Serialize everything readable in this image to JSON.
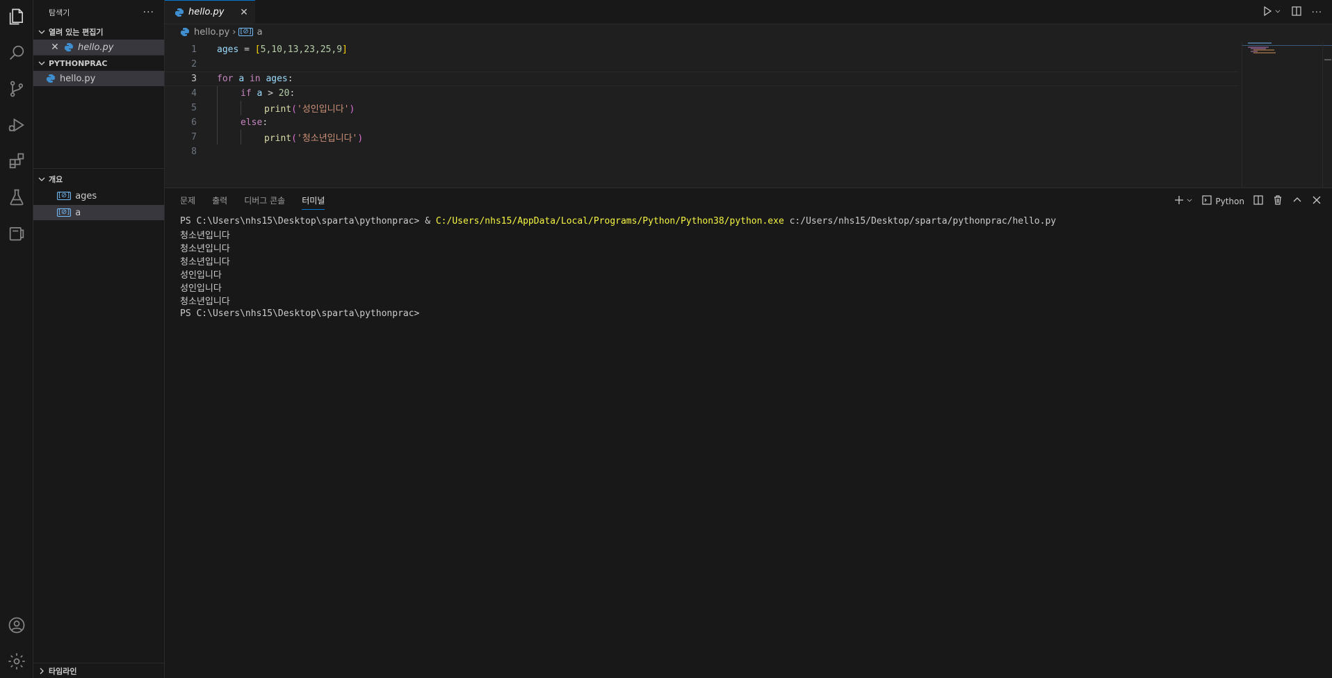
{
  "sidebar": {
    "title": "탐색기",
    "more": "···",
    "open_editors": {
      "header": "열려 있는 편집기",
      "items": [
        {
          "label": "hello.py"
        }
      ]
    },
    "project": {
      "header": "PYTHONPRAC",
      "items": [
        {
          "label": "hello.py"
        }
      ]
    },
    "outline": {
      "header": "개요",
      "items": [
        {
          "label": "ages",
          "icon": "[⊘]"
        },
        {
          "label": "a",
          "icon": "[⊘]"
        }
      ]
    },
    "timeline": {
      "header": "타임라인"
    }
  },
  "editor": {
    "tab": {
      "label": "hello.py"
    },
    "breadcrumb": {
      "file": "hello.py",
      "symbol": "a",
      "separator": "›"
    },
    "lines": [
      "1",
      "2",
      "3",
      "4",
      "5",
      "6",
      "7",
      "8"
    ]
  },
  "code": {
    "l1": {
      "var": "ages",
      "eq": " = ",
      "open": "[",
      "nums": "5,10,13,23,25,9",
      "close": "]"
    },
    "l3": {
      "for": "for",
      "a": "a",
      "in": "in",
      "ages": "ages",
      "colon": ":"
    },
    "l4": {
      "if": "if",
      "a": "a",
      "gt": " > ",
      "num": "20",
      "colon": ":"
    },
    "l5": {
      "fn": "print",
      "open": "(",
      "str": "'성인입니다'",
      "close": ")"
    },
    "l6": {
      "else": "else",
      "colon": ":"
    },
    "l7": {
      "fn": "print",
      "open": "(",
      "str": "'청소년입니다'",
      "close": ")"
    }
  },
  "panel": {
    "tabs": [
      {
        "label": "문제"
      },
      {
        "label": "출력"
      },
      {
        "label": "디버그 콘솔"
      },
      {
        "label": "터미널"
      }
    ],
    "terminal_profile": "Python",
    "terminal": {
      "cmd_prompt": "PS C:\\Users\\nhs15\\Desktop\\sparta\\pythonprac> & ",
      "cmd_exe": "C:/Users/nhs15/AppData/Local/Programs/Python/Python38/python.exe",
      "cmd_arg": " c:/Users/nhs15/Desktop/sparta/pythonprac/hello.py",
      "outputs": [
        "청소년입니다",
        "청소년입니다",
        "청소년입니다",
        "성인입니다",
        "성인입니다",
        "청소년입니다"
      ],
      "final_prompt": "PS C:\\Users\\nhs15\\Desktop\\sparta\\pythonprac>"
    }
  },
  "colors": {
    "accent": "#0078d4",
    "python_icon": "#3e8ed0",
    "terminal_yellow": "#f5f543"
  }
}
